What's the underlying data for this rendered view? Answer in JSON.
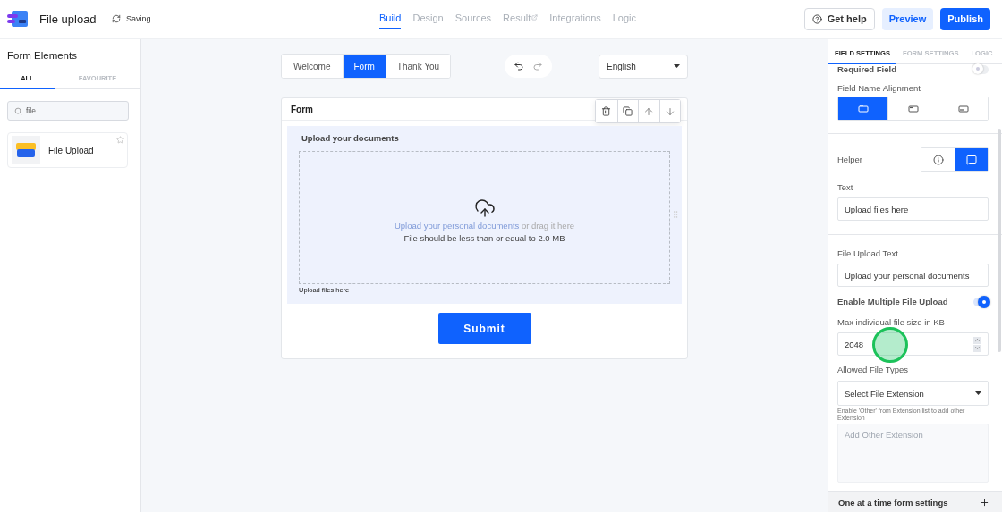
{
  "app": {
    "title": "File upload",
    "status": "Saving.."
  },
  "nav": [
    {
      "label": "Build",
      "selected": true,
      "external": false
    },
    {
      "label": "Design",
      "selected": false,
      "external": false
    },
    {
      "label": "Sources",
      "selected": false,
      "external": false
    },
    {
      "label": "Result",
      "selected": false,
      "external": true
    },
    {
      "label": "Integrations",
      "selected": false,
      "external": false
    },
    {
      "label": "Logic",
      "selected": false,
      "external": false
    }
  ],
  "header_buttons": [
    {
      "label": "Get help",
      "kind": "outline"
    },
    {
      "label": "Preview",
      "kind": "soft"
    },
    {
      "label": "Publish",
      "kind": "primary"
    }
  ],
  "sidebar": {
    "title": "Form Elements",
    "tabs": [
      {
        "label": "ALL",
        "selected": true
      },
      {
        "label": "FAVOURITE",
        "selected": false
      }
    ],
    "search": {
      "value": "file"
    },
    "items": [
      {
        "label": "File Upload",
        "favourite": false
      }
    ]
  },
  "steps": [
    {
      "label": "Welcome",
      "selected": false
    },
    {
      "label": "Form",
      "selected": true
    },
    {
      "label": "Thank You",
      "selected": false
    }
  ],
  "language": {
    "value": "English"
  },
  "form": {
    "title": "Form",
    "field": {
      "label": "Upload your documents",
      "link": "Upload your personal documents",
      "drag_text": "or drag it here",
      "limit": "File should be less than or equal to 2.0 MB",
      "helper": "Upload files here"
    },
    "submit": "Submit"
  },
  "settings": {
    "tabs": [
      {
        "label": "FIELD SETTINGS",
        "selected": true
      },
      {
        "label": "FORM SETTINGS",
        "selected": false
      },
      {
        "label": "LOGIC",
        "selected": false
      }
    ],
    "required": {
      "label": "Required Field",
      "on": false
    },
    "alignment": {
      "label": "Field Name Alignment",
      "options": [
        {
          "kind": "top",
          "selected": true
        },
        {
          "kind": "middle",
          "selected": false
        },
        {
          "kind": "bottom",
          "selected": false
        }
      ]
    },
    "helper": {
      "label": "Helper",
      "options": [
        {
          "kind": "info",
          "selected": false
        },
        {
          "kind": "text",
          "selected": true
        }
      ]
    },
    "text": {
      "label": "Text",
      "value": "Upload files here"
    },
    "upload_text": {
      "label": "File Upload Text",
      "value": "Upload your personal documents"
    },
    "multiple": {
      "label": "Enable Multiple File Upload",
      "on": true
    },
    "max_size": {
      "label": "Max individual file size in KB",
      "value": "2048"
    },
    "file_types": {
      "label": "Allowed File Types",
      "value": "Select File Extension",
      "hint": "Enable 'Other' from Extension list to add other Extension"
    },
    "other_extension": {
      "placeholder": "Add Other Extension"
    },
    "accordion": {
      "label": "One at a time form settings",
      "expanded": false
    }
  },
  "click_highlight": true
}
